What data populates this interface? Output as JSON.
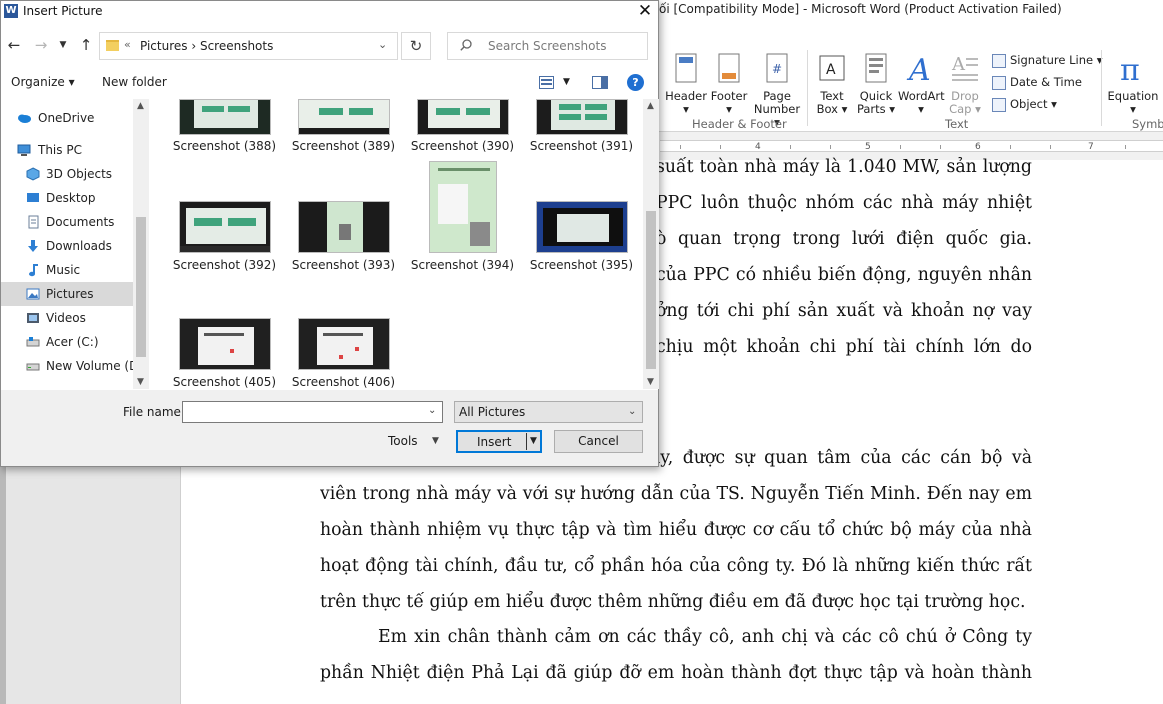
{
  "word": {
    "title": "ối [Compatibility Mode]  -  Microsoft Word (Product Activation Failed)",
    "ribbon": {
      "buttons": [
        {
          "line1": "Header",
          "line2": "▾"
        },
        {
          "line1": "Footer",
          "line2": "▾"
        },
        {
          "line1": "Page",
          "line2": "Number ▾"
        },
        {
          "line1": "Text",
          "line2": "Box ▾"
        },
        {
          "line1": "Quick",
          "line2": "Parts ▾"
        },
        {
          "line1": "WordArt",
          "line2": "▾"
        },
        {
          "line1": "Drop",
          "line2": "Cap ▾"
        },
        {
          "line1": "Equation",
          "line2": "▾"
        }
      ],
      "small": [
        "Signature Line ▾",
        "Date & Time",
        "Object ▾"
      ],
      "groups": [
        "Header & Footer",
        "Text",
        "Symbo"
      ]
    },
    "ruler_numbers": [
      "4",
      "5",
      "6",
      "7"
    ],
    "doc_lines_top": [
      "suất toàn nhà máy là 1.040 MW, sản lượng",
      "PPC luôn thuộc nhóm các nhà máy nhiệt điện",
      "ò quan trọng trong lưới điện quốc gia. Doanh",
      "của PPC có nhiều biến động, nguyên nhân là",
      "ởng tới chi phí sản xuất và khoản nợ vay dài",
      "chịu một khoản chi phí tài chính lớn do chênh"
    ],
    "doc_lines_bottom": [
      "áy, được sự quan tâm của các cán bộ và nhân",
      "viên trong nhà máy và với sự hướng dẫn của TS. Nguyễn Tiến Minh. Đến nay em đã",
      "hoàn thành nhiệm vụ thực tập và tìm hiểu được cơ cấu tổ chức bộ máy của nhà máy,",
      "hoạt động tài chính, đầu tư, cổ phần hóa của công ty. Đó là những kiến thức rất bổ ích",
      "trên thực tế giúp em hiểu được thêm những điều em đã được học tại trường học.",
      "Em xin chân thành cảm ơn các thầy cô, anh chị và các cô chú ở Công ty Cổ",
      "phần Nhiệt điện Phả Lại đã giúp đỡ em hoàn thành đợt thực tập và hoàn thành bài báo"
    ]
  },
  "dialog": {
    "app_icon": "W",
    "title": "Insert Picture",
    "close": "✕",
    "address": {
      "chevron": "«",
      "path": "Pictures  ›  Screenshots"
    },
    "search_placeholder": "Search Screenshots",
    "commands": {
      "organize": "Organize ▾",
      "new_folder": "New folder",
      "help": "?"
    },
    "sidebar": [
      {
        "label": "OneDrive",
        "icon": "cloud-icon"
      },
      {
        "label": "This PC",
        "icon": "computer-icon"
      },
      {
        "label": "3D Objects",
        "icon": "cube-icon"
      },
      {
        "label": "Desktop",
        "icon": "desktop-icon"
      },
      {
        "label": "Documents",
        "icon": "documents-icon"
      },
      {
        "label": "Downloads",
        "icon": "download-icon"
      },
      {
        "label": "Music",
        "icon": "music-icon"
      },
      {
        "label": "Pictures",
        "icon": "pictures-icon",
        "selected": true
      },
      {
        "label": "Videos",
        "icon": "videos-icon"
      },
      {
        "label": "Acer (C:)",
        "icon": "drive-icon"
      },
      {
        "label": "New Volume (D:",
        "icon": "drive-icon"
      }
    ],
    "files": [
      "Screenshot (388)",
      "Screenshot (389)",
      "Screenshot (390)",
      "Screenshot (391)",
      "Screenshot (392)",
      "Screenshot (393)",
      "Screenshot (394)",
      "Screenshot (395)",
      "Screenshot (405)",
      "Screenshot (406)"
    ],
    "file_name_label": "File name:",
    "file_name_value": "",
    "filter": "All Pictures",
    "tools": "Tools",
    "insert": "Insert",
    "cancel": "Cancel",
    "colors": {
      "accent": "#0078d7",
      "selection": "#d9d9d9",
      "help": "#1f6fd1"
    }
  }
}
